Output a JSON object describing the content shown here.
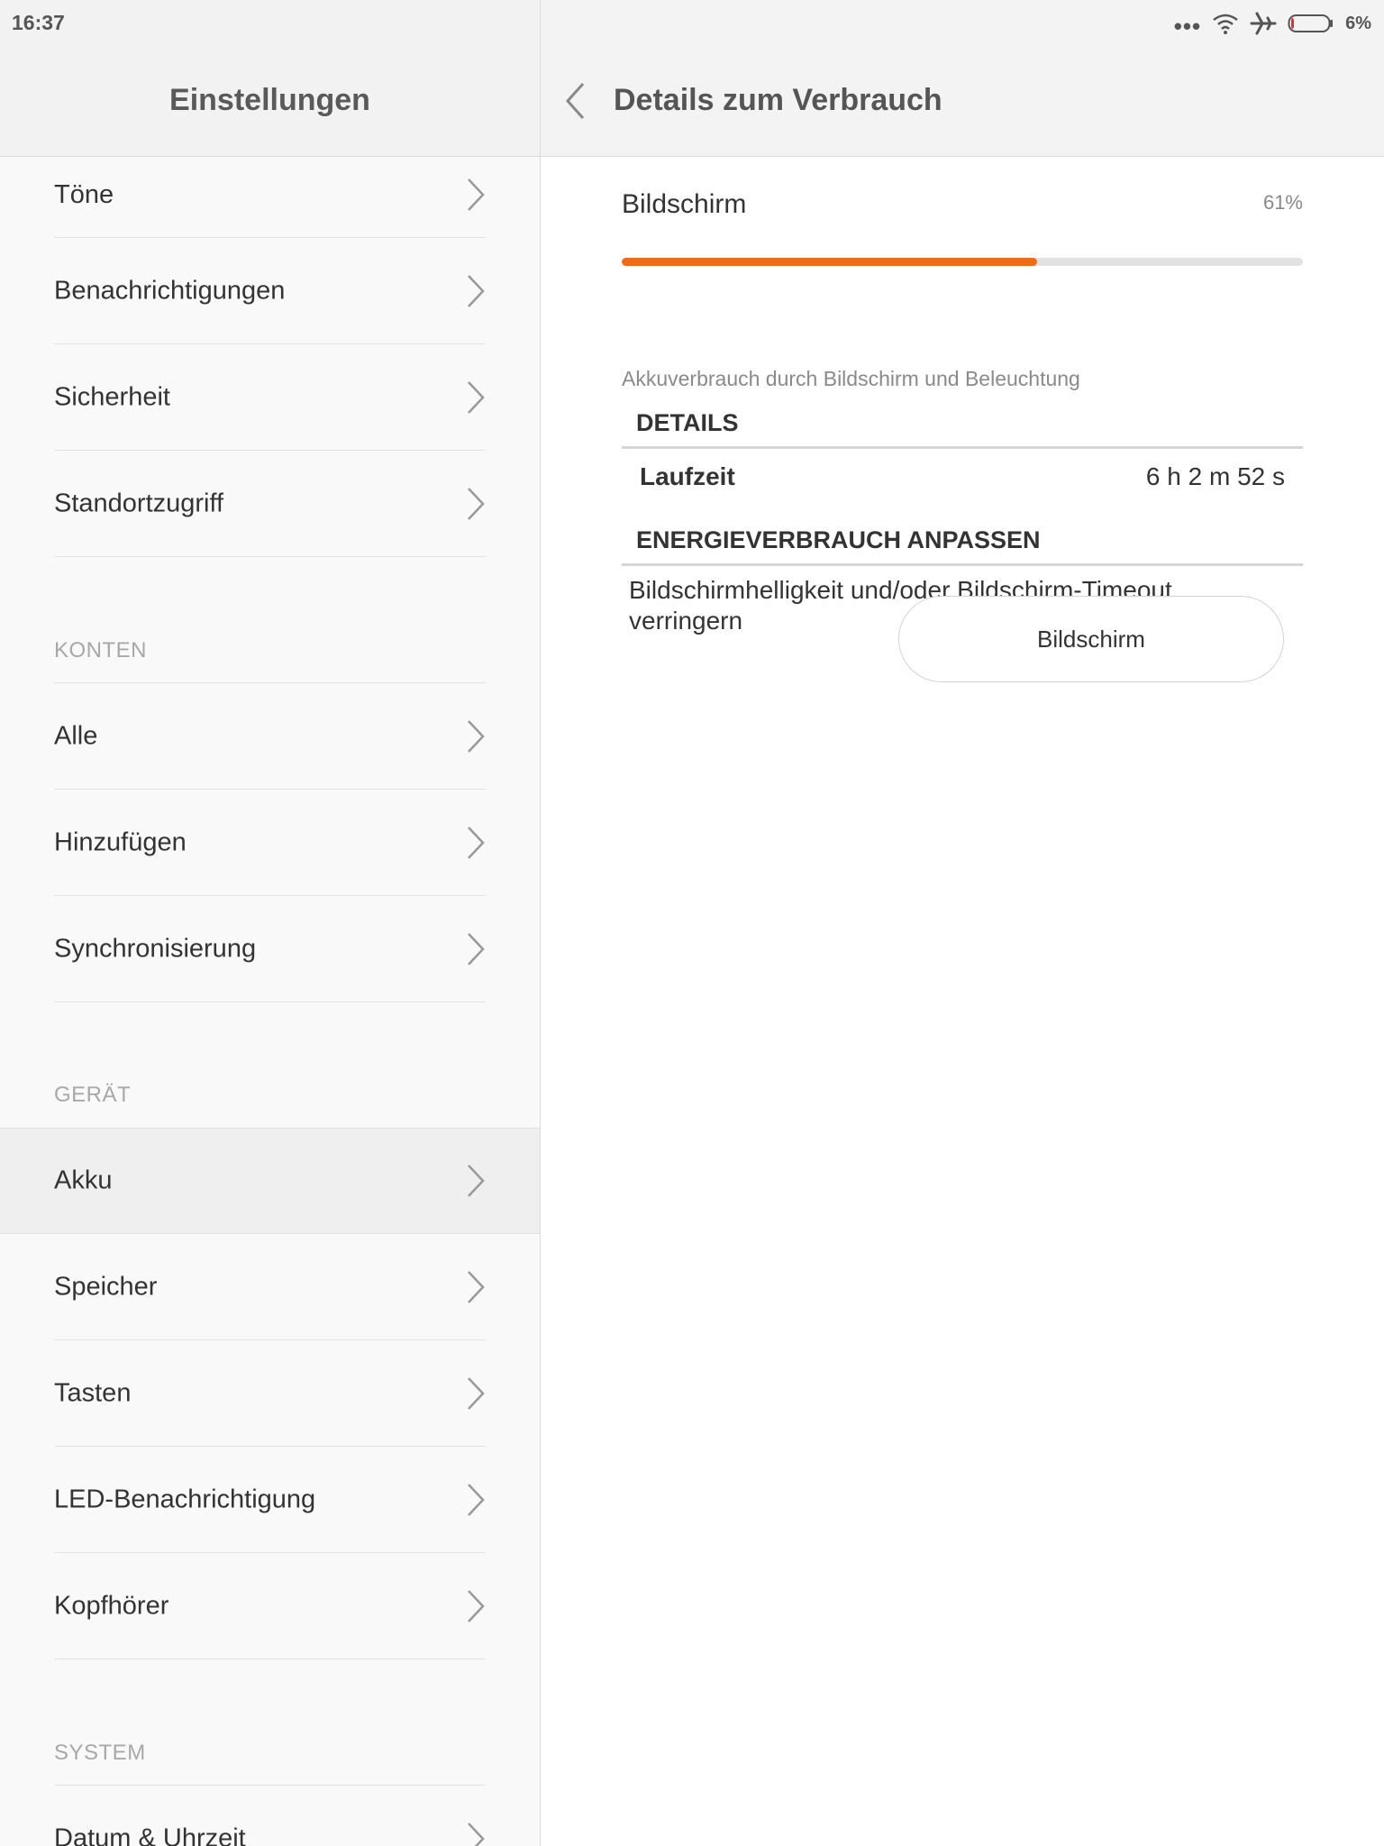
{
  "status_bar": {
    "time": "16:37",
    "more_icon": "more-dots-icon",
    "wifi_icon": "wifi-icon",
    "airplane_icon": "airplane-icon",
    "battery_icon": "battery-icon",
    "battery_level": 0.06,
    "battery_percent": "6%"
  },
  "left_pane": {
    "title": "Einstellungen",
    "items_top": [
      {
        "label": "Töne"
      },
      {
        "label": "Benachrichtigungen"
      },
      {
        "label": "Sicherheit"
      },
      {
        "label": "Standortzugriff"
      }
    ],
    "section_accounts": "KONTEN",
    "items_accounts": [
      {
        "label": "Alle"
      },
      {
        "label": "Hinzufügen"
      },
      {
        "label": "Synchronisierung"
      }
    ],
    "section_device": "GERÄT",
    "items_device": [
      {
        "label": "Akku",
        "selected": true
      },
      {
        "label": "Speicher"
      },
      {
        "label": "Tasten"
      },
      {
        "label": "LED-Benachrichtigung"
      },
      {
        "label": "Kopfhörer"
      }
    ],
    "section_system": "SYSTEM",
    "items_system": [
      {
        "label": "Datum & Uhrzeit"
      }
    ]
  },
  "right_pane": {
    "title": "Details zum Verbrauch",
    "usage": {
      "label": "Bildschirm",
      "percent_text": "61%",
      "percent_value": 0.61,
      "bar_color": "#f26b12",
      "description": "Akkuverbrauch durch Bildschirm und Beleuchtung"
    },
    "details": {
      "title": "DETAILS",
      "runtime_label": "Laufzeit",
      "runtime_value": "6 h 2 m 52 s"
    },
    "adjust": {
      "title": "ENERGIEVERBRAUCH ANPASSEN",
      "tip": "Bildschirmhelligkeit und/oder Bildschirm-Timeout verringern",
      "button_label": "Bildschirm"
    }
  }
}
